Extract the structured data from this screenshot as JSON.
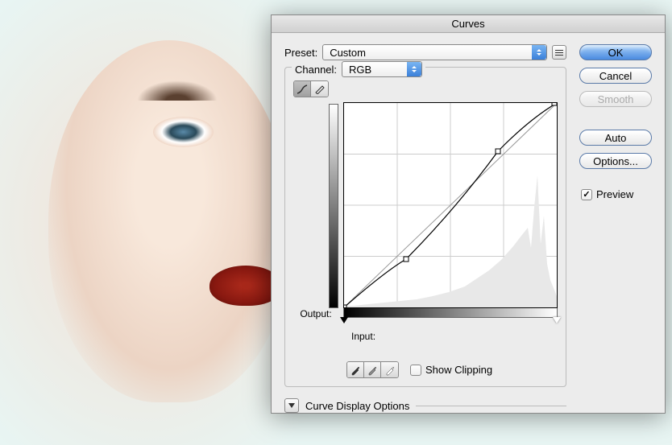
{
  "dialog": {
    "title": "Curves",
    "preset_label": "Preset:",
    "preset_value": "Custom",
    "channel_label": "Channel:",
    "channel_value": "RGB",
    "output_label": "Output:",
    "input_label": "Input:",
    "show_clipping_label": "Show Clipping",
    "show_clipping_checked": false,
    "display_options_label": "Curve Display Options"
  },
  "buttons": {
    "ok": "OK",
    "cancel": "Cancel",
    "smooth": "Smooth",
    "auto": "Auto",
    "options": "Options..."
  },
  "preview": {
    "label": "Preview",
    "checked": true
  },
  "chart_data": {
    "type": "line",
    "title": "Curves Adjustment",
    "xlabel": "Input",
    "ylabel": "Output",
    "xlim": [
      0,
      255
    ],
    "ylim": [
      0,
      255
    ],
    "grid": {
      "rows": 4,
      "cols": 4
    },
    "series": [
      {
        "name": "RGB curve",
        "points": [
          {
            "x": 0,
            "y": 0
          },
          {
            "x": 75,
            "y": 60
          },
          {
            "x": 185,
            "y": 195
          },
          {
            "x": 255,
            "y": 255
          }
        ]
      }
    ],
    "histogram_approx": [
      5,
      3,
      2,
      2,
      2,
      2,
      2,
      3,
      3,
      3,
      4,
      4,
      4,
      5,
      5,
      6,
      6,
      6,
      7,
      7,
      8,
      8,
      8,
      9,
      9,
      10,
      10,
      10,
      11,
      11,
      12,
      12,
      13,
      13,
      14,
      15,
      15,
      16,
      17,
      18,
      20,
      22,
      25,
      26,
      28,
      30,
      32,
      34,
      36,
      38,
      40,
      42,
      44,
      46,
      48,
      50,
      52,
      54,
      56,
      58,
      55,
      50,
      45,
      38,
      60,
      90,
      30,
      20,
      15,
      10
    ]
  }
}
